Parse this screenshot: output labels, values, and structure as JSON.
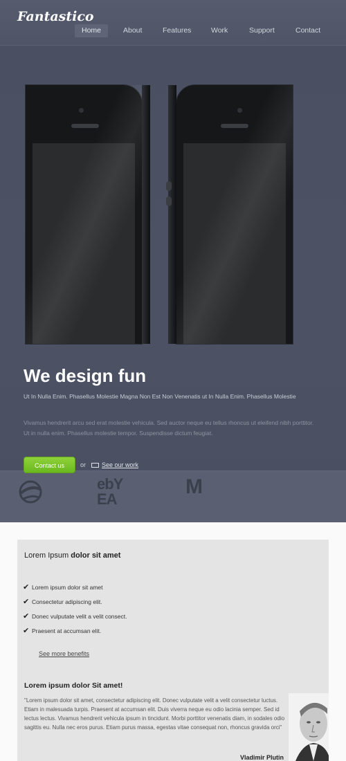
{
  "brand": {
    "logo_text": "Fantastico"
  },
  "nav": {
    "items": [
      {
        "label": "Home",
        "active": true
      },
      {
        "label": "About"
      },
      {
        "label": "Features"
      },
      {
        "label": "Work"
      },
      {
        "label": "Support"
      },
      {
        "label": "Contact"
      }
    ]
  },
  "hero": {
    "headline": "We design fun",
    "paragraph_1": "Ut In Nulla Enim. Phasellus Molestie Magna Non Est Non Venenatis ut In Nulla Enim. Phasellus Molestie",
    "paragraph_2": "Vivamus hendrerit arcu sed erat molestie vehicula. Sed auctor neque eu tellus rhoncus ut eleifend nibh porttitor. Ut in nulla enim. Phasellus molestie tempor. Suspendisse dictum feugiat.",
    "cta_label": "Contact us",
    "or_text": "or",
    "work_link": "See our work"
  },
  "clients": {
    "logos": [
      {
        "name": "Pepsi",
        "icon": "pepsi-logo"
      },
      {
        "name": "eBay EA",
        "icon": "ebay-ea-logo",
        "text_top": "ebY",
        "text_bottom": "EA"
      },
      {
        "name": "McDonald's",
        "icon": "mcdonalds-logo",
        "text": "M"
      }
    ]
  },
  "benefits": {
    "title_bold": "Lorem Ipsum",
    "title_rest": "dolor sit amet",
    "items": [
      "Lorem ipsum dolor sit amet",
      "Consectetur adipiscing elit.",
      "Donec vulputate velit a velit consect.",
      "Praesent at accumsan elit."
    ],
    "more_link": "See more benefits"
  },
  "testimonial": {
    "title": "Lorem ipsum dolor Sit amet!",
    "text": "\"Lorem ipsum dolor sit amet, consectetur adipiscing elit. Donec vulputate velit a velit consectetur luctus. Etiam in malesuada turpis. Praesent at accumsan elit. Duis viverra neque eu odio lacinia semper. Sed id lectus lectus. Vivamus hendrerit vehicula ipsum in tincidunt. Morbi porttitor venenatis diam, in sodales odio sagittis eu. Nulla nec eros purus. Etiam purus massa, egestas vitae consequat non, rhoncus gravida orci\"",
    "author": "Vladimir Plutin"
  },
  "colors": {
    "hero_bg": "#4c5264",
    "cta_green": "#7bc62a",
    "content_bg": "#e4e4e4"
  }
}
